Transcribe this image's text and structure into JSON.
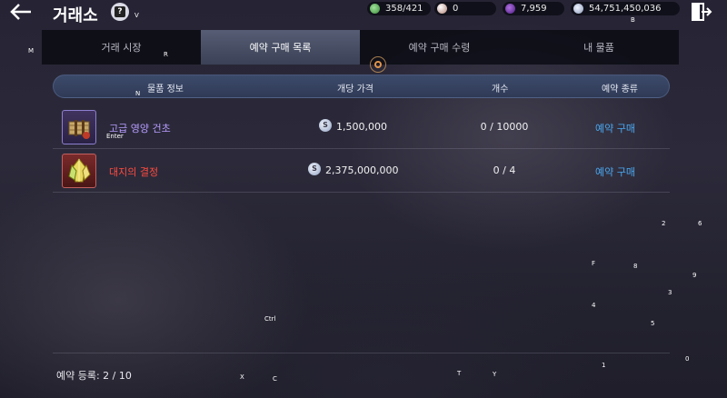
{
  "header": {
    "back_label": "←",
    "title": "거래소",
    "help_icon_label": "?",
    "help_hotkey": "V"
  },
  "currencies": [
    {
      "name": "energy",
      "value": "358/421",
      "color": "#5fbf5a"
    },
    {
      "name": "pearl",
      "value": "0",
      "color": "#d9b8b0"
    },
    {
      "name": "crystal",
      "value": "7,959",
      "color": "#8a3fd0"
    },
    {
      "name": "silver",
      "value": "54,751,450,036",
      "color": "#b8c4dc"
    }
  ],
  "currency_hotkey": "B",
  "tabs": [
    {
      "label": "거래 시장",
      "active": false
    },
    {
      "label": "예약 구매 목록",
      "active": true
    },
    {
      "label": "예약 구매 수령",
      "active": false
    },
    {
      "label": "내 물품",
      "active": false
    }
  ],
  "tab_hotkeys": {
    "left": "M",
    "market": "R"
  },
  "table": {
    "columns": [
      "물품 정보",
      "개당 가격",
      "개수",
      "예약 종류"
    ],
    "header_hotkey": "N",
    "rows": [
      {
        "name": "고급 영양 건초",
        "grade_color": "#b79cff",
        "icon": "hay-bundle-icon",
        "price": "1,500,000",
        "quantity": "0 / 10000",
        "type": "예약 구매",
        "hotkey": "Enter"
      },
      {
        "name": "대지의 결정",
        "grade_color": "#ff4b40",
        "icon": "earth-crystal-icon",
        "price": "2,375,000,000",
        "quantity": "0 / 4",
        "type": "예약 구매",
        "hotkey": ""
      }
    ]
  },
  "footer": {
    "reservation_count": "예약 등록: 2 / 10"
  },
  "overlay_hotkeys": [
    {
      "key": "Ctrl"
    },
    {
      "key": "X"
    },
    {
      "key": "C"
    },
    {
      "key": "T"
    },
    {
      "key": "Y"
    },
    {
      "key": "2"
    },
    {
      "key": "6"
    },
    {
      "key": "F"
    },
    {
      "key": "8"
    },
    {
      "key": "9"
    },
    {
      "key": "3"
    },
    {
      "key": "4"
    },
    {
      "key": "5"
    },
    {
      "key": "1"
    },
    {
      "key": "0"
    }
  ],
  "accent_colors": {
    "active_tab": "#4a5068",
    "reserve_link": "#4aa8f0",
    "header_pill": "#35415f"
  }
}
